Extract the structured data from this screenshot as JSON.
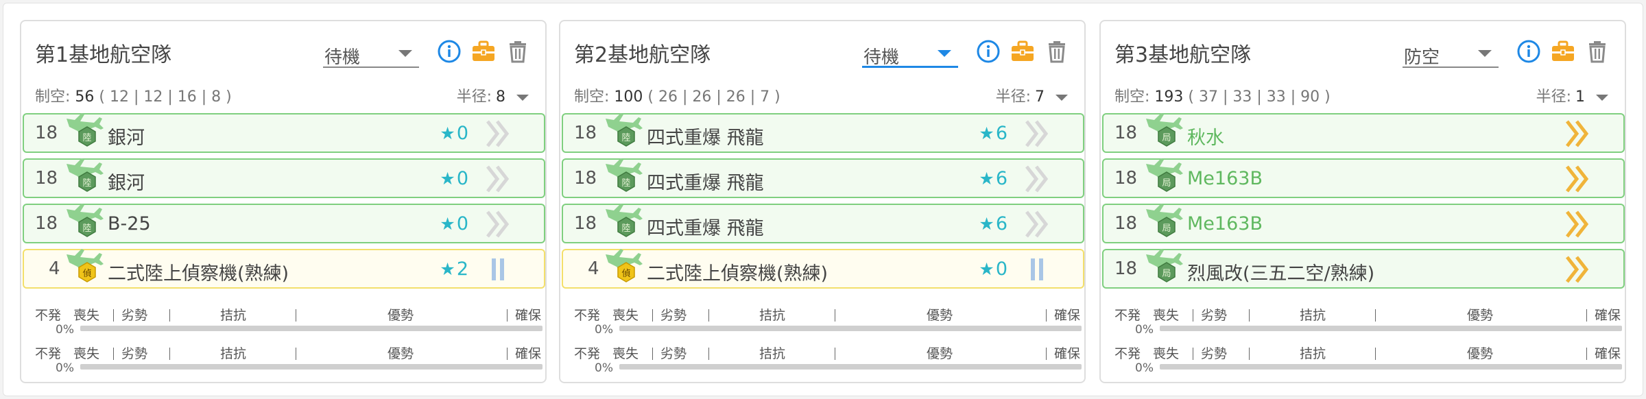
{
  "engagement_labels": {
    "no_launch": "不発",
    "no_launch_pct": "0%",
    "loss": "喪失",
    "disadvantage": "劣勢",
    "parity": "拮抗",
    "advantage": "優勢",
    "supremacy": "確保"
  },
  "colors": {
    "slot_border_green": "#7fcf7f",
    "slot_border_yellow": "#f3df6b",
    "info_blue": "#1e88e5",
    "briefcase_orange": "#f5a623",
    "star_teal": "#29b6c8",
    "plane_green": "#5fb85f"
  },
  "panels": [
    {
      "title": "第1基地航空隊",
      "status": "待機",
      "status_active": false,
      "stats_label": "制空:",
      "stats_value": "56",
      "stats_breakdown": "( 12 | 12 | 16 | 8 )",
      "radius_label": "半径:",
      "radius_value": "8",
      "slots": [
        {
          "count": "18",
          "name": "銀河",
          "badge": "陸",
          "stars": "0",
          "prof": "double-chevron-gray",
          "type": "attack",
          "green_name": false
        },
        {
          "count": "18",
          "name": "銀河",
          "badge": "陸",
          "stars": "0",
          "prof": "double-chevron-gray",
          "type": "attack",
          "green_name": false
        },
        {
          "count": "18",
          "name": "B-25",
          "badge": "陸",
          "stars": "0",
          "prof": "double-chevron-gray",
          "type": "attack",
          "green_name": false
        },
        {
          "count": "4",
          "name": "二式陸上偵察機(熟練)",
          "badge": "偵",
          "stars": "2",
          "prof": "double-bar-blue",
          "type": "recon",
          "green_name": false
        }
      ]
    },
    {
      "title": "第2基地航空隊",
      "status": "待機",
      "status_active": true,
      "stats_label": "制空:",
      "stats_value": "100",
      "stats_breakdown": "( 26 | 26 | 26 | 7 )",
      "radius_label": "半径:",
      "radius_value": "7",
      "slots": [
        {
          "count": "18",
          "name": "四式重爆 飛龍",
          "badge": "陸",
          "stars": "6",
          "prof": "double-chevron-gray",
          "type": "attack",
          "green_name": false
        },
        {
          "count": "18",
          "name": "四式重爆 飛龍",
          "badge": "陸",
          "stars": "6",
          "prof": "double-chevron-gray",
          "type": "attack",
          "green_name": false
        },
        {
          "count": "18",
          "name": "四式重爆 飛龍",
          "badge": "陸",
          "stars": "6",
          "prof": "double-chevron-gray",
          "type": "attack",
          "green_name": false
        },
        {
          "count": "4",
          "name": "二式陸上偵察機(熟練)",
          "badge": "偵",
          "stars": "0",
          "prof": "double-bar-blue",
          "type": "recon",
          "green_name": false
        }
      ]
    },
    {
      "title": "第3基地航空隊",
      "status": "防空",
      "status_active": false,
      "stats_label": "制空:",
      "stats_value": "193",
      "stats_breakdown": "( 37 | 33 | 33 | 90 )",
      "radius_label": "半径:",
      "radius_value": "1",
      "slots": [
        {
          "count": "18",
          "name": "秋水",
          "badge": "局",
          "stars": "",
          "prof": "double-chevron-orange",
          "type": "interceptor",
          "green_name": true
        },
        {
          "count": "18",
          "name": "Me163B",
          "badge": "局",
          "stars": "",
          "prof": "double-chevron-orange",
          "type": "interceptor",
          "green_name": true
        },
        {
          "count": "18",
          "name": "Me163B",
          "badge": "局",
          "stars": "",
          "prof": "double-chevron-orange",
          "type": "interceptor",
          "green_name": true
        },
        {
          "count": "18",
          "name": "烈風改(三五二空/熟練)",
          "badge": "局",
          "stars": "",
          "prof": "double-chevron-orange",
          "type": "interceptor",
          "green_name": false
        }
      ]
    }
  ]
}
